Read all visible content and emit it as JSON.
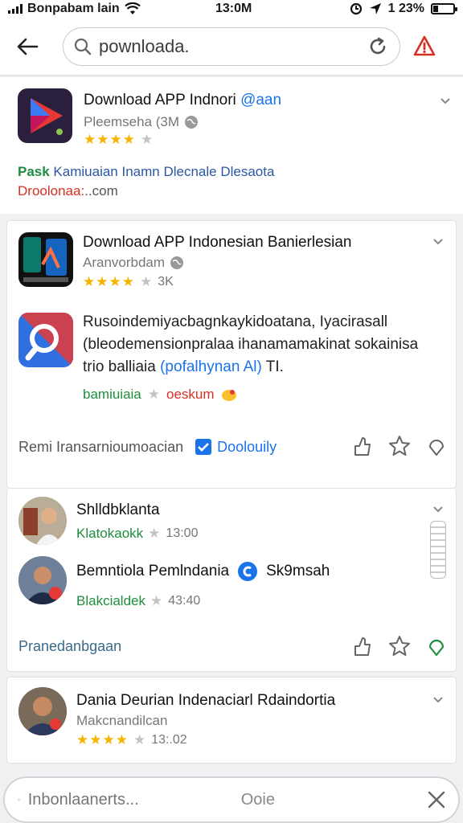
{
  "status": {
    "carrier": "Bonpabam lain",
    "time": "13:0M",
    "battery": "1 23%",
    "battery_level": 0.23
  },
  "search": {
    "value": "pownloada."
  },
  "results": [
    {
      "title": "Download APP Indnori",
      "title_tag": "@aan",
      "subtitle": "Pleemseha (3M",
      "rating": 4.5,
      "desc_line1_bold": "Pask",
      "desc_line1": " Kamiuaian Inamn Dlecnale Dlesaota",
      "domain_prefix": "Droolonaa:",
      "domain_suffix": "..com"
    },
    {
      "title": "Download APP Indonesian Banierlesian",
      "subtitle": "Aranvorbdam",
      "rating": 4.5,
      "rating_count": "3K",
      "body_line1": "Rusoindemiyacbagnkaykidoatana, Iyacirasall",
      "body_line2": "(bleodemensionpralaa ihanamamakinat sokainisa",
      "body_line3_start": "trio balliaia ",
      "body_line3_link": "(pofalhynan Al)",
      "body_line3_end": " TI.",
      "tag_green": "bamiuiaia",
      "tag_red": "oeskum",
      "footer_text": "Remi Iransarnioumoacian",
      "footer_link": "Doolouily"
    },
    {
      "item1_name": "Shlldbklanta",
      "item1_handle": "Klatokaokk",
      "item1_time": "13:00",
      "item2_name": "Bemntiola Pemlndania",
      "item2_badge": "Sk9msah",
      "item2_handle": "Blakcialdek",
      "item2_time": "43:40",
      "footer_text": "Pranedanbgaan"
    },
    {
      "title": "Dania Deurian Indenaciarl Rdaindortia",
      "subtitle": "Makcnandilcan",
      "rating": 4.5,
      "time": "13:.02"
    }
  ],
  "bottom": {
    "placeholder": "Inbonlaanerts...",
    "hint": "Ooie"
  },
  "colors": {
    "accent": "#1a73e8",
    "alert": "#d93025",
    "star": "#f4b400",
    "green": "#1e8e3e"
  }
}
